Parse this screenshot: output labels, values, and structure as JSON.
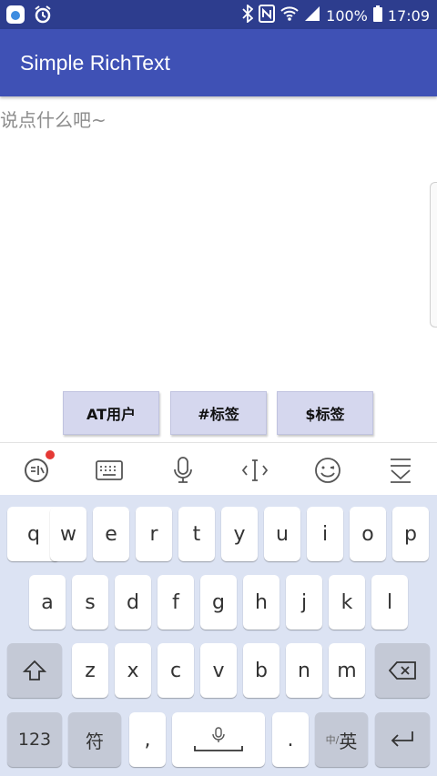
{
  "status_bar": {
    "battery": "100%",
    "time": "17:09"
  },
  "app_bar": {
    "title": "Simple RichText"
  },
  "editor": {
    "placeholder": "说点什么吧~"
  },
  "buttons": [
    {
      "label": "AT用户"
    },
    {
      "label": "#标签"
    },
    {
      "label": "$标签"
    }
  ],
  "keyboard": {
    "row1": [
      "q",
      "w",
      "e",
      "r",
      "t",
      "y",
      "u",
      "i",
      "o",
      "p"
    ],
    "row2": [
      "a",
      "s",
      "d",
      "f",
      "g",
      "h",
      "j",
      "k",
      "l"
    ],
    "row3": [
      "z",
      "x",
      "c",
      "v",
      "b",
      "n",
      "m"
    ],
    "num_key": "123",
    "symbol_key": "符",
    "comma_key": ",",
    "period_key": ".",
    "lang_key_small": "中/",
    "lang_key": "英"
  },
  "colors": {
    "app_bar": "#3f51b5",
    "status_bar": "#2d3d8e",
    "keyboard_bg": "#dce3f3"
  }
}
